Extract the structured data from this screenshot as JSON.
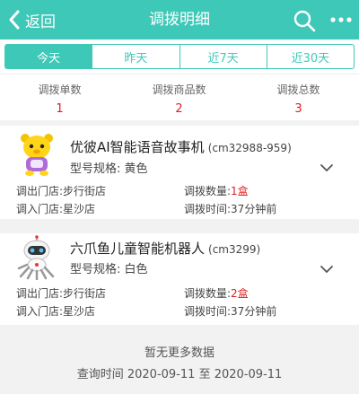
{
  "header": {
    "back_label": "返回",
    "title": "调拨明细"
  },
  "tabs": [
    {
      "label": "今天",
      "active": true
    },
    {
      "label": "昨天",
      "active": false
    },
    {
      "label": "近7天",
      "active": false
    },
    {
      "label": "近30天",
      "active": false
    }
  ],
  "stats": [
    {
      "label": "调拨单数",
      "value": "1"
    },
    {
      "label": "调拨商品数",
      "value": "2"
    },
    {
      "label": "调拨总数",
      "value": "3"
    }
  ],
  "items": [
    {
      "name": "优彼AI智能语音故事机",
      "code": "(cm32988-959)",
      "spec_label": "型号规格:",
      "spec_value": "黄色",
      "out_store_label": "调出门店:",
      "out_store": "步行街店",
      "in_store_label": "调入门店:",
      "in_store": "星沙店",
      "qty_label": "调拨数量:",
      "qty": "1盒",
      "time_label": "调拨时间:",
      "time": "37分钟前",
      "image": "yellow-bear-toy"
    },
    {
      "name": "六爪鱼儿童智能机器人",
      "code": "(cm3299)",
      "spec_label": "型号规格:",
      "spec_value": "白色",
      "out_store_label": "调出门店:",
      "out_store": "步行街店",
      "in_store_label": "调入门店:",
      "in_store": "星沙店",
      "qty_label": "调拨数量:",
      "qty": "2盒",
      "time_label": "调拨时间:",
      "time": "37分钟前",
      "image": "white-robot-toy"
    }
  ],
  "footer": {
    "no_more": "暂无更多数据",
    "query_label": "查询时间",
    "date_from": "2020-09-11",
    "date_sep": "至",
    "date_to": "2020-09-11"
  },
  "colors": {
    "accent": "#3ec8b8",
    "highlight": "#e02020"
  }
}
